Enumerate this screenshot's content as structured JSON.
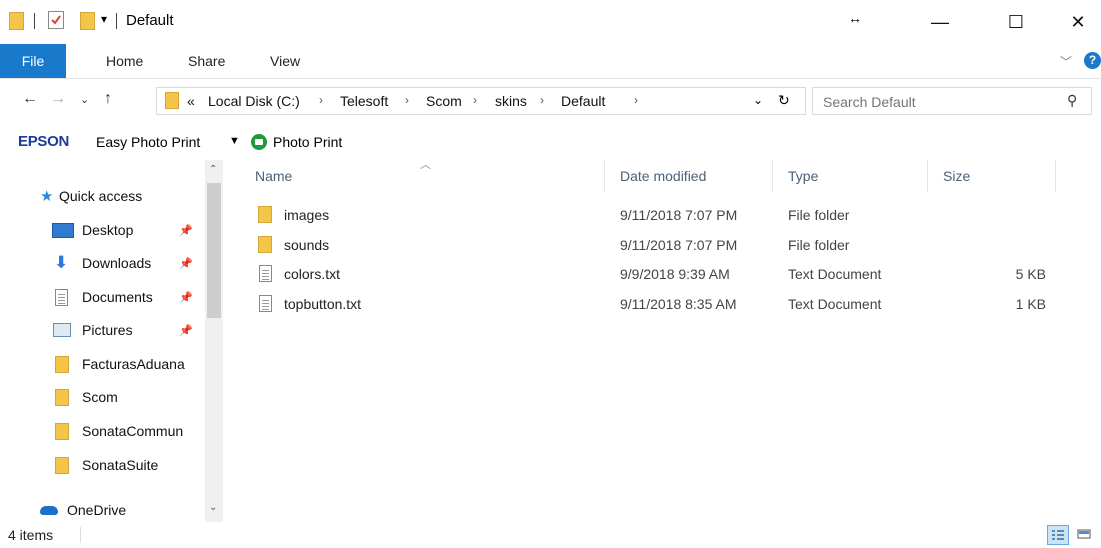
{
  "window": {
    "title": "Default",
    "minimize_glyph": "—",
    "maximize_glyph": "☐",
    "close_glyph": "✕",
    "resize_glyph": "↔"
  },
  "ribbon": {
    "tabs": [
      {
        "label": "File"
      },
      {
        "label": "Home"
      },
      {
        "label": "Share"
      },
      {
        "label": "View"
      }
    ],
    "accent_color": "#1979ca"
  },
  "address": {
    "overflow": "«",
    "breadcrumbs": [
      "Local Disk (C:)",
      "Telesoft",
      "Scom",
      "skins",
      "Default"
    ],
    "search_placeholder": "Search Default"
  },
  "epson": {
    "brand": "EPSON",
    "label": "Easy Photo Print",
    "photo_print": "Photo Print"
  },
  "nav_pane": {
    "items": [
      {
        "label": "Quick access",
        "icon": "star-icon",
        "pinned": false
      },
      {
        "label": "Desktop",
        "icon": "desktop-icon",
        "pinned": true
      },
      {
        "label": "Downloads",
        "icon": "download-icon",
        "pinned": true
      },
      {
        "label": "Documents",
        "icon": "documents-icon",
        "pinned": true
      },
      {
        "label": "Pictures",
        "icon": "pictures-icon",
        "pinned": true
      },
      {
        "label": "FacturasAduana",
        "icon": "folder-icon",
        "pinned": false
      },
      {
        "label": "Scom",
        "icon": "folder-icon",
        "pinned": false
      },
      {
        "label": "SonataCommun",
        "icon": "folder-icon",
        "pinned": false
      },
      {
        "label": "SonataSuite",
        "icon": "folder-icon",
        "pinned": false
      },
      {
        "label": "OneDrive",
        "icon": "cloud-icon",
        "pinned": false
      }
    ]
  },
  "file_list": {
    "columns": [
      "Name",
      "Date modified",
      "Type",
      "Size"
    ],
    "rows": [
      {
        "name": "images",
        "date": "9/11/2018 7:07 PM",
        "type": "File folder",
        "size": "",
        "icon": "folder-icon"
      },
      {
        "name": "sounds",
        "date": "9/11/2018 7:07 PM",
        "type": "File folder",
        "size": "",
        "icon": "folder-icon"
      },
      {
        "name": "colors.txt",
        "date": "9/9/2018 9:39 AM",
        "type": "Text Document",
        "size": "5 KB",
        "icon": "text-file-icon"
      },
      {
        "name": "topbutton.txt",
        "date": "9/11/2018 8:35 AM",
        "type": "Text Document",
        "size": "1 KB",
        "icon": "text-file-icon"
      }
    ]
  },
  "status": {
    "item_count": "4 items"
  }
}
